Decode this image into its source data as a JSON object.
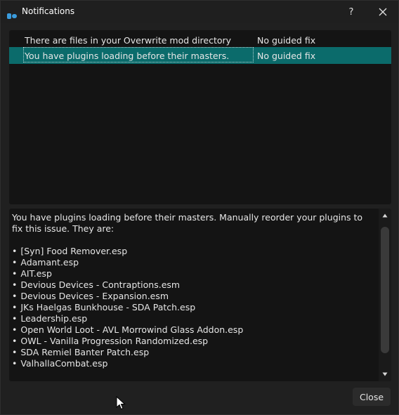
{
  "window": {
    "title": "Notifications",
    "help_label": "?",
    "icons": {
      "app": "mod-organizer-icon",
      "help": "help-icon",
      "close": "close-icon",
      "scroll_up": "chevron-up-icon",
      "scroll_down": "chevron-down-icon"
    },
    "colors": {
      "selected_row": "#0b6b6b",
      "app_icon": "#3a9bdc"
    }
  },
  "issues": [
    {
      "description": "There are files in your Overwrite mod directory",
      "fix": "No guided fix"
    },
    {
      "description": "You have plugins loading before their masters.",
      "fix": "No guided fix",
      "selected": true
    }
  ],
  "details": {
    "intro": "You have plugins loading before their masters. Manually reorder your plugins to fix this issue. They are:",
    "plugins": [
      "[Syn] Food Remover.esp",
      "Adamant.esp",
      "AIT.esp",
      "Devious Devices - Contraptions.esm",
      "Devious Devices - Expansion.esm",
      "JKs Haelgas Bunkhouse - SDA Patch.esp",
      "Leadership.esp",
      "Open World Loot - AVL Morrowind Glass Addon.esp",
      "OWL - Vanilla Progression Randomized.esp",
      "SDA Remiel Banter Patch.esp",
      "ValhallaCombat.esp"
    ]
  },
  "buttons": {
    "close_label": "Close"
  }
}
